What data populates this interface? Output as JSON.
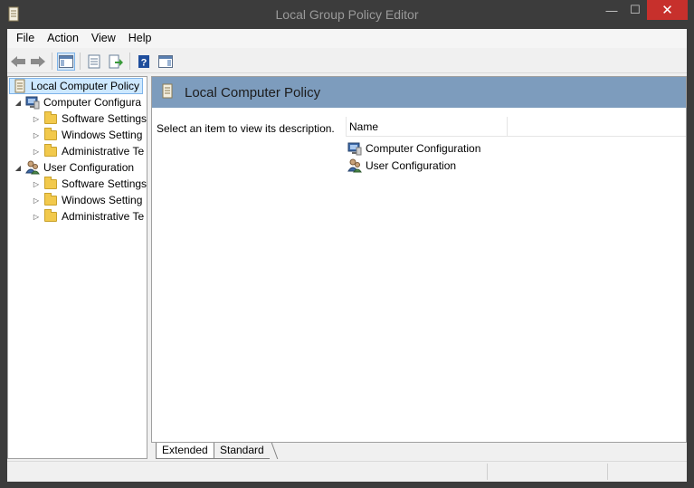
{
  "window": {
    "title": "Local Group Policy Editor",
    "controls": {
      "minimize": "—",
      "maximize": "☐",
      "close": "✕"
    }
  },
  "menu": [
    "File",
    "Action",
    "View",
    "Help"
  ],
  "toolbar": {
    "buttons": [
      "back-icon",
      "forward-icon",
      "show-hide-console-tree-icon",
      "properties-icon",
      "export-list-icon",
      "help-icon",
      "show-hide-action-pane-icon"
    ]
  },
  "tree": {
    "root": "Local Computer Policy",
    "computer": {
      "label": "Computer Configura",
      "children": [
        "Software Settings",
        "Windows Setting",
        "Administrative Te"
      ]
    },
    "user": {
      "label": "User Configuration",
      "children": [
        "Software Settings",
        "Windows Setting",
        "Administrative Te"
      ]
    }
  },
  "content": {
    "header_title": "Local Computer Policy",
    "description": "Select an item to view its description.",
    "column_name": "Name",
    "items": [
      "Computer Configuration",
      "User Configuration"
    ]
  },
  "tabs": [
    "Extended",
    "Standard"
  ],
  "colors": {
    "title_bar": "#3c3c3c",
    "close_button": "#c7302c",
    "header_bar": "#7d9cbd",
    "selection": "#cde8ff"
  }
}
